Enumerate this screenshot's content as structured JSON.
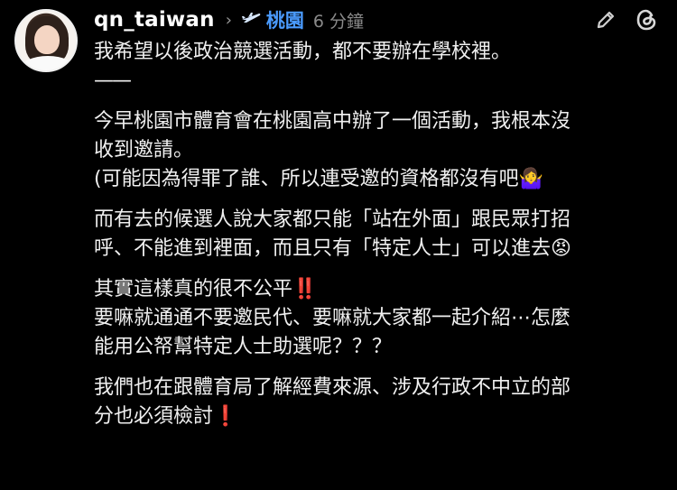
{
  "post": {
    "username": "qn_taiwan",
    "chevron": "›",
    "location_icon": "airplane-icon",
    "location": "桃園",
    "time": "6 分鐘",
    "lines": [
      "我希望以後政治競選活動，都不要辦在學校裡。",
      "——",
      "今早桃園市體育會在桃園高中辦了一個活動，我根本沒",
      "收到邀請。",
      "(可能因為得罪了誰、所以連受邀的資格都沒有吧🤷‍♀️",
      "而有去的候選人說大家都只能「站在外面」跟民眾打招",
      "呼、不能進到裡面，而且只有「特定人士」可以進去😡",
      "其實這樣真的很不公平‼️",
      "要嘛就通通不要邀民代、要嘛就大家都一起介紹⋯怎麼",
      "能用公帑幫特定人士助選呢？？？",
      "我們也在跟體育局了解經費來源、涉及行政不中立的部",
      "分也必須檢討❗️"
    ]
  },
  "colors": {
    "background": "#000000",
    "text": "#f0f0f0",
    "location": "#4a9bff",
    "muted": "#8a8a8a"
  }
}
